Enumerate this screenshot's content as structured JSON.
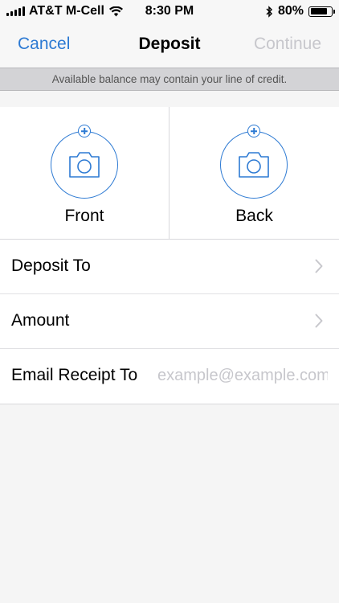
{
  "status_bar": {
    "carrier": "AT&T M-Cell",
    "time": "8:30 PM",
    "battery_percent": "80%",
    "battery_level": 0.8,
    "icons": [
      "signal-icon",
      "wifi-icon",
      "bluetooth-icon",
      "battery-icon"
    ]
  },
  "nav": {
    "cancel_label": "Cancel",
    "title": "Deposit",
    "continue_label": "Continue"
  },
  "notice": {
    "text": "Available balance may contain your line of credit."
  },
  "capture": {
    "front_label": "Front",
    "back_label": "Back",
    "icons": [
      "camera-icon",
      "plus-icon"
    ]
  },
  "form": {
    "deposit_to_label": "Deposit To",
    "amount_label": "Amount",
    "email_label": "Email Receipt To",
    "email_placeholder": "example@example.com",
    "email_value": ""
  },
  "colors": {
    "accent": "#2d7ad3",
    "disabled": "#c7c7cc",
    "notice_bg": "#d3d3d6"
  }
}
